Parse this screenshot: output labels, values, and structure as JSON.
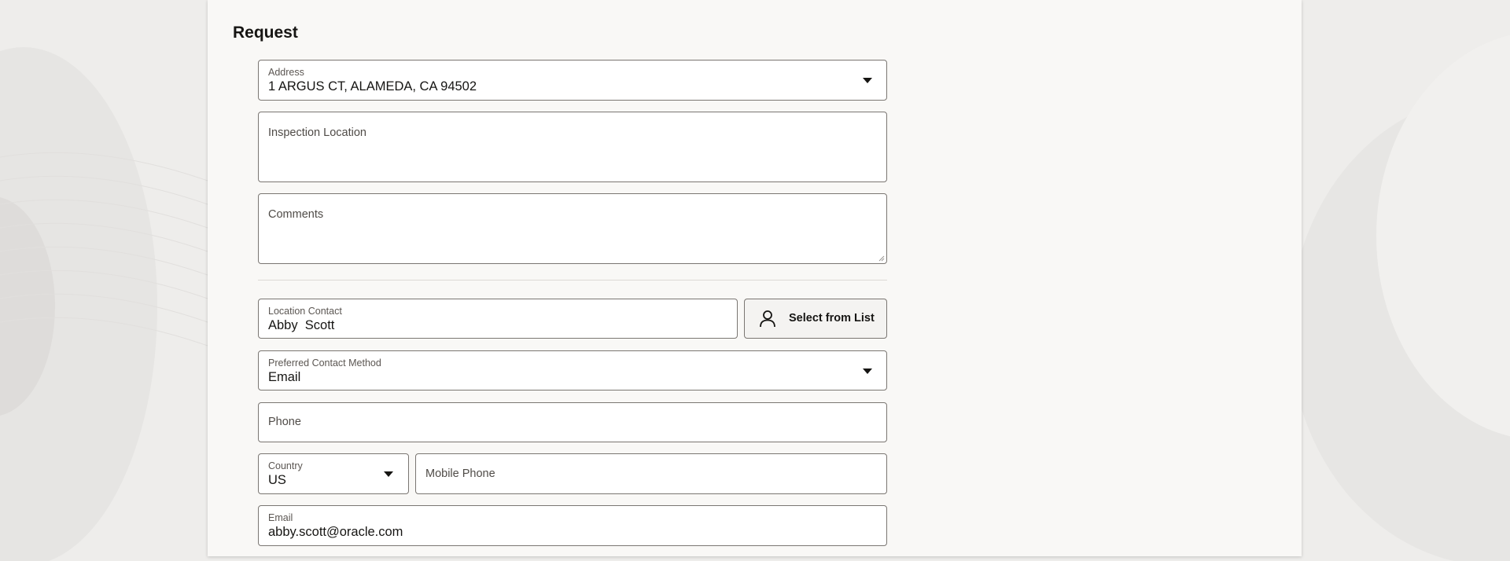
{
  "section": {
    "title": "Request"
  },
  "address": {
    "label": "Address",
    "value": "1 ARGUS CT, ALAMEDA, CA 94502",
    "icon": "chevron-down-icon"
  },
  "inspection_location": {
    "placeholder": "Inspection Location"
  },
  "comments": {
    "placeholder": "Comments"
  },
  "location_contact": {
    "label": "Location Contact",
    "value": "Abby  Scott"
  },
  "select_from_list": {
    "label": "Select from List",
    "icon": "person-icon"
  },
  "preferred_contact_method": {
    "label": "Preferred Contact Method",
    "value": "Email",
    "icon": "chevron-down-icon"
  },
  "phone": {
    "placeholder": "Phone"
  },
  "country": {
    "label": "Country",
    "value": "US",
    "icon": "chevron-down-icon"
  },
  "mobile_phone": {
    "placeholder": "Mobile Phone"
  },
  "email": {
    "label": "Email",
    "value": "abby.scott@oracle.com"
  },
  "colors": {
    "page_bg": "#eeedeb",
    "panel_bg": "#f9f8f6",
    "border": "#7a7672",
    "text": "#161513"
  }
}
